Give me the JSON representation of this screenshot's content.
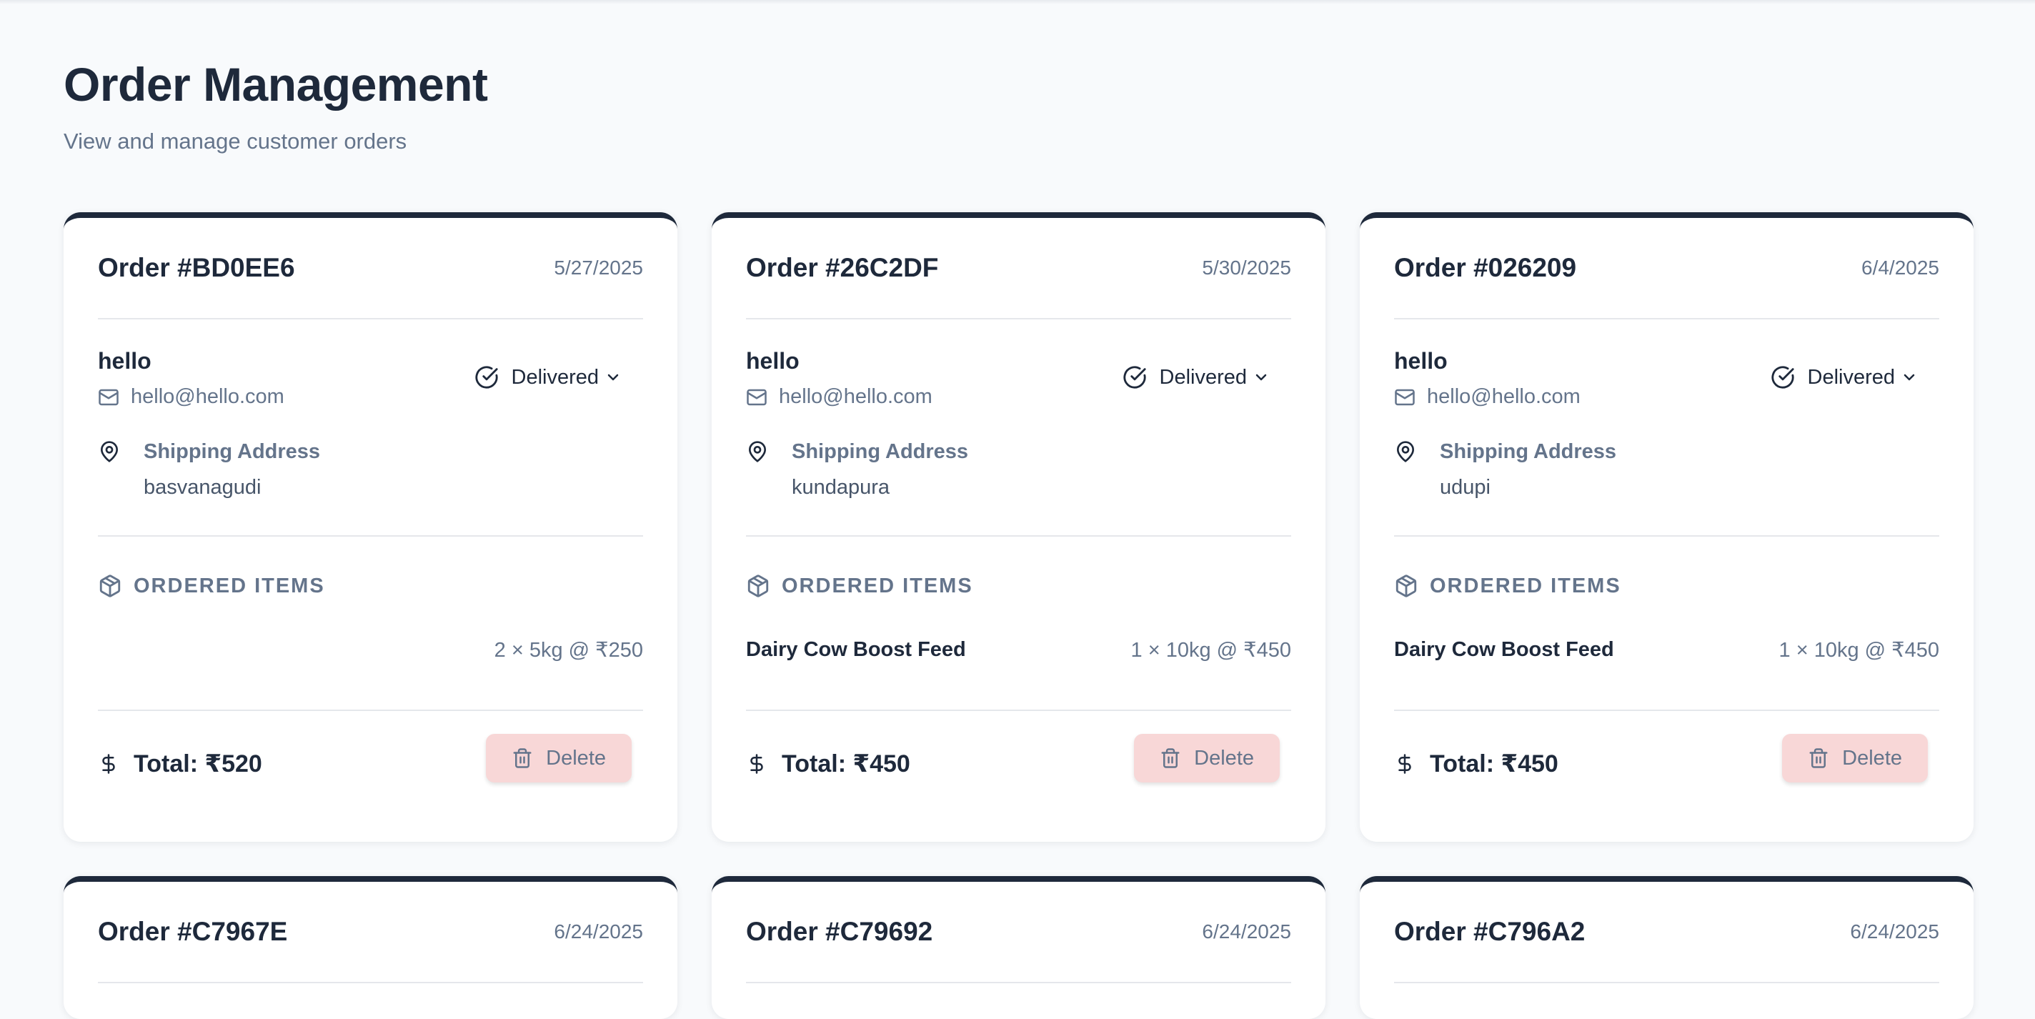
{
  "page": {
    "title": "Order Management",
    "subtitle": "View and manage customer orders"
  },
  "labels": {
    "shipping_address": "Shipping Address",
    "ordered_items": "ORDERED ITEMS",
    "delete": "Delete"
  },
  "orders": [
    {
      "id": "Order #BD0EE6",
      "date": "5/27/2025",
      "customer": "hello",
      "email": "hello@hello.com",
      "status": "Delivered",
      "address": "basvanagudi",
      "item_name": "",
      "item_qty": "2 × 5kg @ ₹250",
      "total": "Total: ₹520"
    },
    {
      "id": "Order #26C2DF",
      "date": "5/30/2025",
      "customer": "hello",
      "email": "hello@hello.com",
      "status": "Delivered",
      "address": "kundapura",
      "item_name": "Dairy Cow Boost Feed",
      "item_qty": "1 × 10kg @ ₹450",
      "total": "Total: ₹450"
    },
    {
      "id": "Order #026209",
      "date": "6/4/2025",
      "customer": "hello",
      "email": "hello@hello.com",
      "status": "Delivered",
      "address": "udupi",
      "item_name": "Dairy Cow Boost Feed",
      "item_qty": "1 × 10kg @ ₹450",
      "total": "Total: ₹450"
    },
    {
      "id": "Order #C7967E",
      "date": "6/24/2025"
    },
    {
      "id": "Order #C79692",
      "date": "6/24/2025"
    },
    {
      "id": "Order #C796A2",
      "date": "6/24/2025"
    }
  ],
  "colors": {
    "card_accent": "#1e293b",
    "delete_bg": "#f8d7d7",
    "muted_text": "#64748b"
  },
  "icons": [
    "mail-icon",
    "check-circle-icon",
    "chevron-down-icon",
    "map-pin-icon",
    "package-icon",
    "dollar-icon",
    "trash-icon"
  ]
}
